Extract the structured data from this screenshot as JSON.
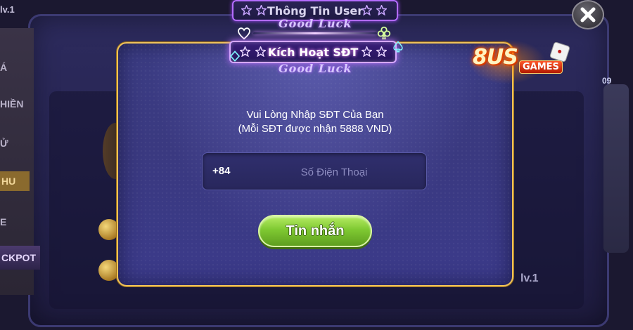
{
  "background": {
    "level_top": "lv.1",
    "level_bottom": "lv.1",
    "side_labels": [
      "Á",
      "HIỀN",
      "Ử",
      "HU",
      "E"
    ],
    "jackpot": "CKPOT",
    "right_num": "09"
  },
  "tabs": [
    {
      "label": "Thông Tin User",
      "tagline": "Good Luck",
      "active": false
    },
    {
      "label": "Kích Hoạt SĐT",
      "tagline": "Good Luck",
      "active": true
    }
  ],
  "logo": {
    "brand": "8US",
    "suffix": "GAMES"
  },
  "dialog": {
    "line1": "Vui Lòng Nhập SĐT Của Bạn",
    "line2": "(Mỗi SĐT được nhận 5888 VND)",
    "phone_prefix": "+84",
    "phone_placeholder": "Số Điện Thoại",
    "phone_value": "",
    "submit_label": "Tin nhắn"
  },
  "icons": {
    "close": "close-icon",
    "star": "star-icon",
    "suits": [
      "heart-suit-icon",
      "club-suit-icon",
      "diamond-suit-icon",
      "spade-suit-icon"
    ]
  },
  "colors": {
    "dialog_border": "#f0c35a",
    "button_green": "#7fc932",
    "tab_glow": "#c070ff",
    "dialog_bg": "#3a3980"
  }
}
